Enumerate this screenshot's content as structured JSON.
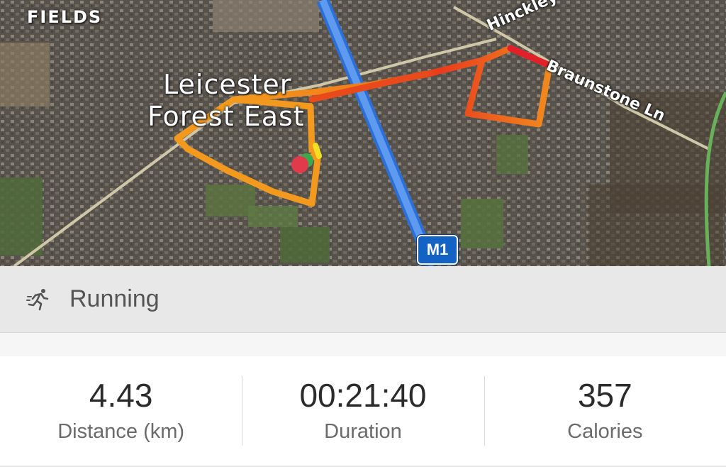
{
  "map": {
    "place_line1": "Leicester",
    "place_line2": "Forest East",
    "top_label": "FIELDS",
    "road_hinckley": "Hinckley Rd",
    "road_braunstone": "Braunstone Ln",
    "motorway": "M1",
    "route_colors": {
      "start": "#f0a020",
      "mid": "#f07018",
      "end": "#e82020"
    },
    "end_marker_color": "#e23a4a",
    "start_marker_color": "#3aaa4a"
  },
  "activity": {
    "icon": "running-icon",
    "label": "Running"
  },
  "stats": [
    {
      "value": "4.43",
      "label": "Distance (km)"
    },
    {
      "value": "00:21:40",
      "label": "Duration"
    },
    {
      "value": "357",
      "label": "Calories"
    }
  ]
}
